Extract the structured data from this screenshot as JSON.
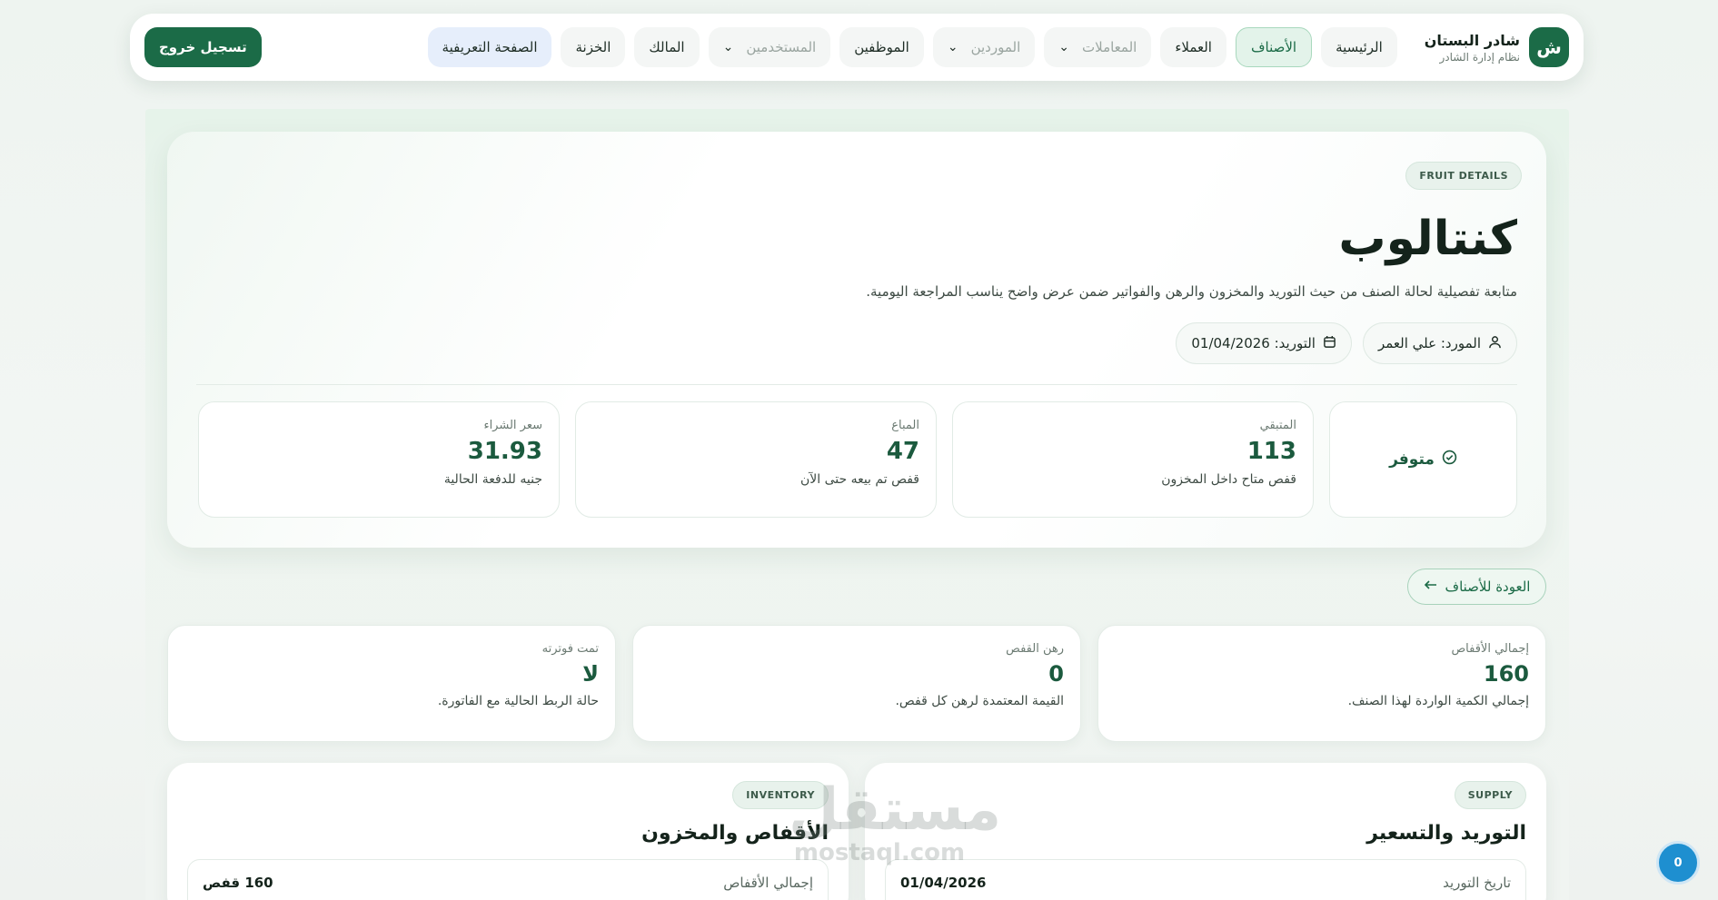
{
  "brand": {
    "logo_letter": "ش",
    "name": "شادر البستان",
    "subtitle": "نظام إدارة الشادر"
  },
  "nav": {
    "home": "الرئيسية",
    "items_categories": "الأصناف",
    "customers": "العملاء",
    "transactions": "المعاملات",
    "suppliers": "الموردين",
    "employees": "الموظفين",
    "users": "المستخدمين",
    "owner": "المالك",
    "treasury": "الخزنة",
    "intro_page": "الصفحة التعريفية",
    "logout": "تسجيل خروج",
    "chevron": "⌄"
  },
  "hero": {
    "badge": "FRUIT DETAILS",
    "title": "كنتالوب",
    "description": "متابعة تفصيلية لحالة الصنف من حيث التوريد والمخزون والرهن والفواتير ضمن عرض واضح يناسب المراجعة اليومية.",
    "supplier_chip": "المورد: علي العمر",
    "supply_chip": "التوريد: 01/04/2026",
    "status": "متوفر",
    "stats": [
      {
        "label": "المتبقي",
        "value": "113",
        "note": "قفص متاح داخل المخزون"
      },
      {
        "label": "المباع",
        "value": "47",
        "note": "قفص تم بيعه حتى الآن"
      },
      {
        "label": "سعر الشراء",
        "value": "31.93",
        "note": "جنيه للدفعة الحالية"
      }
    ]
  },
  "back_button": "العودة للأصناف",
  "summary": [
    {
      "label": "إجمالي الأقفاص",
      "value": "160",
      "note": "إجمالي الكمية الواردة لهذا الصنف."
    },
    {
      "label": "رهن القفص",
      "value": "0",
      "note": "القيمة المعتمدة لرهن كل قفص."
    },
    {
      "label": "تمت فوترته",
      "value": "لا",
      "note": "حالة الربط الحالية مع الفاتورة."
    }
  ],
  "supply_section": {
    "badge": "SUPPLY",
    "title": "التوريد والتسعير",
    "row_label": "تاريخ التوريد",
    "row_value": "01/04/2026"
  },
  "inventory_section": {
    "badge": "INVENTORY",
    "title": "الأقفاص والمخزون",
    "row_label": "إجمالي الأقفاص",
    "row_value": "160 قفص"
  },
  "watermark": {
    "ar": "مستقل",
    "en": "mostaql.com"
  },
  "notification_count": "0"
}
